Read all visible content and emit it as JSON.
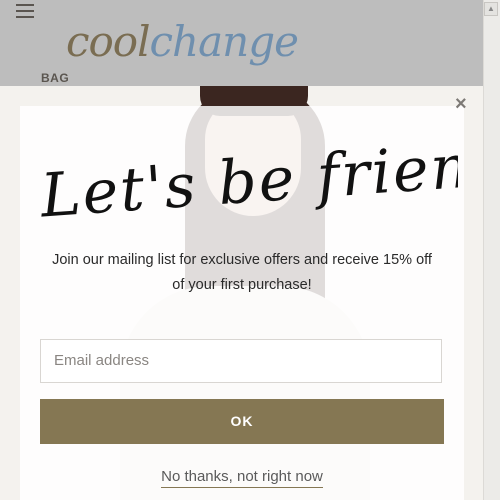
{
  "header": {
    "logo_part1": "cool",
    "logo_part2": "change",
    "subnav_label": "BAG"
  },
  "scrollbar": {
    "up_arrow": "▲"
  },
  "modal": {
    "close_symbol": "×",
    "title": "Let's be friends!",
    "message": "Join our mailing list for exclusive offers and receive 15% off of your first purchase!",
    "email_placeholder": "Email address",
    "ok_label": "OK",
    "decline_label": "No thanks, not right now"
  },
  "colors": {
    "accent": "#857753",
    "logo_brown": "#7a6d52",
    "logo_blue": "#6f8fae",
    "header_bg": "#bdbdbd"
  },
  "icons": [
    "hamburger-menu-icon",
    "close-icon",
    "scroll-up-icon"
  ]
}
